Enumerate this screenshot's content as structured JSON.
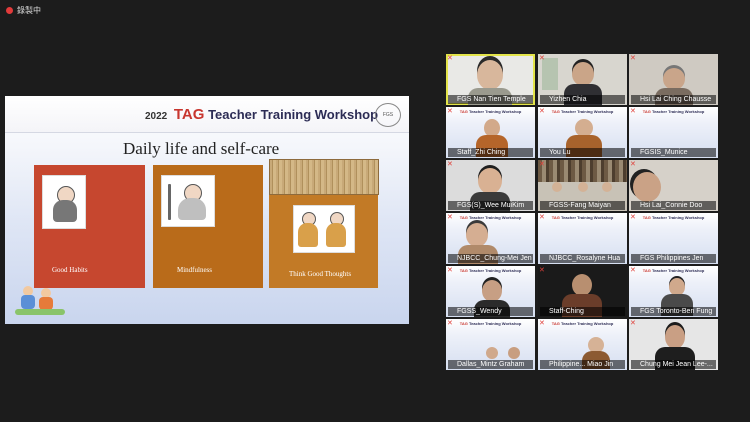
{
  "recording": {
    "label": "錄製中"
  },
  "slide": {
    "year": "2022",
    "tag": "TAG",
    "title_rest": "Teacher Training Workshop",
    "logo_text": "FGS",
    "subtitle": "Daily life and self-care",
    "cards": [
      {
        "label": "Good Habits",
        "color": "#c6472f"
      },
      {
        "label": "Mindfulness",
        "color": "#b96b1a"
      },
      {
        "label": "Think Good Thoughts",
        "color": "#c27a26"
      }
    ]
  },
  "participants": [
    {
      "name": "FGS Nan Tien Temple"
    },
    {
      "name": "Yizhen Chia"
    },
    {
      "name": "Hsi Lai Ching Chausse"
    },
    {
      "name": "Staff_Zhi Ching"
    },
    {
      "name": "You Lu"
    },
    {
      "name": "FGSIS_Munice"
    },
    {
      "name": "FGS(S)_Wee MuiKim"
    },
    {
      "name": "FGSS-Fang Maiyan"
    },
    {
      "name": "Hsi Lai_Connie Doo"
    },
    {
      "name": "NJBCC_Chung-Mei Jen"
    },
    {
      "name": "NJBCC_Rosalyne Hua"
    },
    {
      "name": "FGS Philippines Jen"
    },
    {
      "name": "FGSS_Wendy"
    },
    {
      "name": "Staff-Ching"
    },
    {
      "name": "FGS Toronto-Ben Fung"
    },
    {
      "name": "Dallas_Mintz Graham"
    },
    {
      "name": "Philippine... Miao Jin"
    },
    {
      "name": "Chung Mei Jean Lee-..."
    }
  ],
  "colors": {
    "background": "#1c1c1c",
    "active_speaker": "#e3e44a",
    "muted_mic": "#e0403a"
  }
}
